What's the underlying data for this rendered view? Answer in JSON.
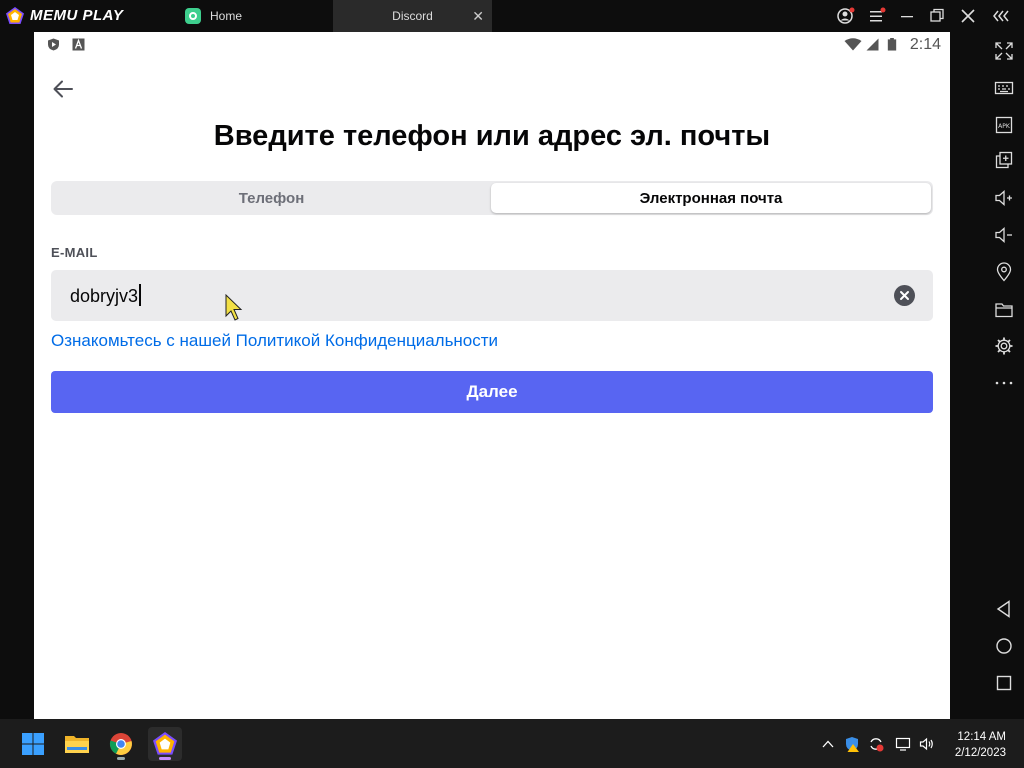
{
  "emulator": {
    "brand": "MEMU PLAY",
    "tabs": [
      {
        "label": "Home",
        "icon": "home-app-icon",
        "active": false
      },
      {
        "label": "Discord",
        "active": true
      }
    ],
    "window_controls": [
      "account-icon",
      "menu-icon",
      "minimize-icon",
      "restore-icon",
      "close-icon",
      "collapse-sidebar-icon"
    ],
    "toolbar": [
      "fullscreen-icon",
      "keyboard-icon",
      "apk-icon",
      "multi-instance-icon",
      "volume-up-icon",
      "volume-down-icon",
      "location-icon",
      "folder-icon",
      "settings-icon",
      "more-icon",
      "android-back-icon",
      "android-home-icon",
      "android-recents-icon"
    ]
  },
  "statusbar": {
    "time": "2:14"
  },
  "page": {
    "title": "Введите телефон или адрес эл. почты",
    "tabs": {
      "phone": "Телефон",
      "email": "Электронная почта",
      "selected": "email"
    },
    "email_label": "E-MAIL",
    "email_value": "dobryjv3",
    "policy_link": "Ознакомьтесь с нашей Политикой Конфиденциальности",
    "next_button": "Далее"
  },
  "taskbar": {
    "apps": [
      "windows-start-icon",
      "file-explorer-icon",
      "chrome-icon",
      "memu-icon"
    ],
    "clock_time": "12:14 AM",
    "clock_date": "2/12/2023"
  },
  "colors": {
    "accent": "#5865f2",
    "link": "#006ce7",
    "input_bg": "#ebebed"
  }
}
